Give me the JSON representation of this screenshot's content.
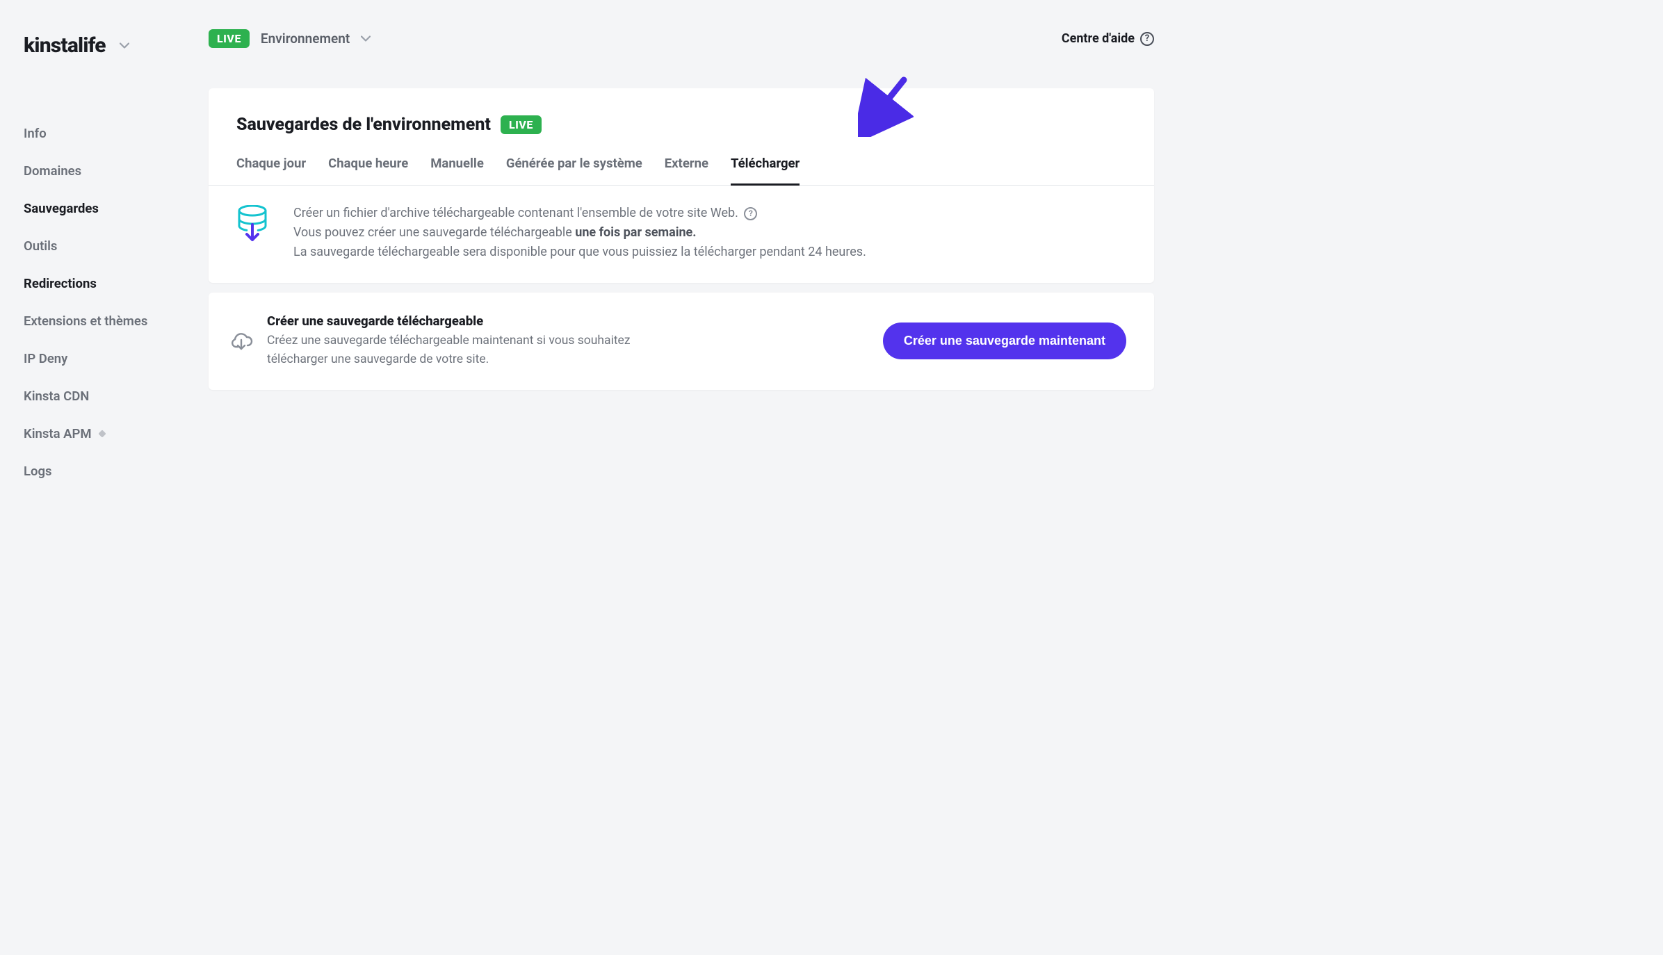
{
  "site": {
    "name": "kinstalife"
  },
  "topbar": {
    "badge": "LIVE",
    "env_label": "Environnement",
    "help_label": "Centre d'aide"
  },
  "sidebar": {
    "items": [
      {
        "label": "Info",
        "active": false
      },
      {
        "label": "Domaines",
        "active": false
      },
      {
        "label": "Sauvegardes",
        "active": true
      },
      {
        "label": "Outils",
        "active": false
      },
      {
        "label": "Redirections",
        "active": true
      },
      {
        "label": "Extensions et thèmes",
        "active": false
      },
      {
        "label": "IP Deny",
        "active": false
      },
      {
        "label": "Kinsta CDN",
        "active": false
      },
      {
        "label": "Kinsta APM",
        "active": false,
        "marker": true
      },
      {
        "label": "Logs",
        "active": false
      }
    ]
  },
  "page": {
    "title": "Sauvegardes de l'environnement",
    "badge": "LIVE",
    "tabs": [
      {
        "label": "Chaque jour",
        "active": false
      },
      {
        "label": "Chaque heure",
        "active": false
      },
      {
        "label": "Manuelle",
        "active": false
      },
      {
        "label": "Générée par le système",
        "active": false
      },
      {
        "label": "Externe",
        "active": false
      },
      {
        "label": "Télécharger",
        "active": true
      }
    ],
    "info_line1": "Créer un fichier d'archive téléchargeable contenant l'ensemble de votre site Web.",
    "info_line2_pre": "Vous pouvez créer une sauvegarde téléchargeable ",
    "info_line2_strong": "une fois par semaine.",
    "info_line3": "La sauvegarde téléchargeable sera disponible pour que vous puissiez la télécharger pendant 24 heures."
  },
  "action": {
    "title": "Créer une sauvegarde téléchargeable",
    "desc": "Créez une sauvegarde téléchargeable maintenant si vous souhaitez télécharger une sauvegarde de votre site.",
    "button": "Créer une sauvegarde maintenant"
  },
  "colors": {
    "accent": "#5333ed",
    "green": "#2db14f",
    "teal": "#14c3cf"
  }
}
